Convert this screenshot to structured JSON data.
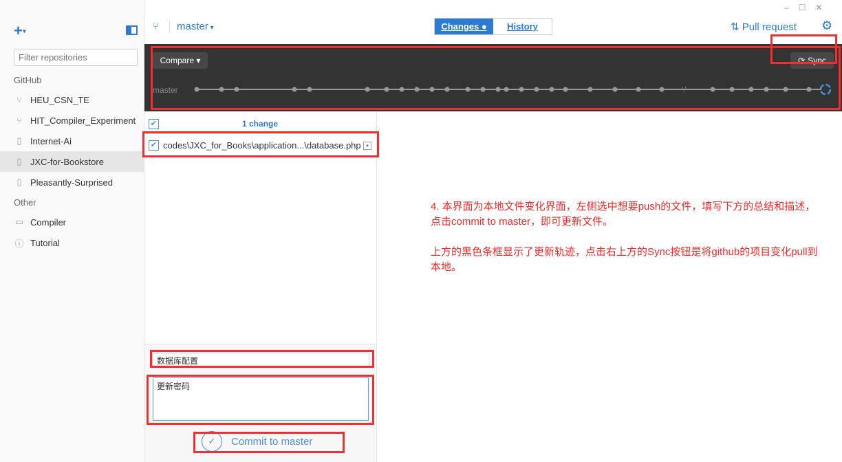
{
  "sidebar": {
    "add_icon": "plus-icon",
    "filter_placeholder": "Filter repositories",
    "sections": [
      {
        "title": "GitHub",
        "items": [
          {
            "label": "HEU_CSN_TE",
            "icon": "fork-icon"
          },
          {
            "label": "HIT_Compiler_Experiment",
            "icon": "fork-icon"
          },
          {
            "label": "Internet-Ai",
            "icon": "repo-icon"
          },
          {
            "label": "JXC-for-Bookstore",
            "icon": "repo-icon",
            "selected": true
          },
          {
            "label": "Pleasantly-Surprised",
            "icon": "repo-icon"
          }
        ]
      },
      {
        "title": "Other",
        "items": [
          {
            "label": "Compiler",
            "icon": "monitor-icon"
          },
          {
            "label": "Tutorial",
            "icon": "info-icon"
          }
        ]
      }
    ]
  },
  "toolbar": {
    "branch": "master",
    "tabs": [
      {
        "label": "Changes ●",
        "active": true
      },
      {
        "label": "History",
        "active": false
      }
    ],
    "pull_request": "Pull request"
  },
  "timeline": {
    "compare_label": "Compare ▾",
    "sync_label": "Sync",
    "branch_label": "master",
    "commit_count": 30
  },
  "changes": {
    "count_label": "1 change",
    "files": [
      {
        "path": "codes\\JXC_for_Books\\application...\\database.php",
        "checked": true
      }
    ]
  },
  "commit": {
    "summary": "数据库配置",
    "description": "更新密码",
    "button": "Commit to master"
  },
  "note": {
    "para1": "4. 本界面为本地文件变化界面，左侧选中想要push的文件，填写下方的总结和描述，点击commit to master，即可更新文件。",
    "para2": "上方的黑色条框显示了更新轨迹，点击右上方的Sync按钮是将github的项目变化pull到本地。"
  },
  "colors": {
    "accent": "#4a90d9",
    "annotation": "#f03030",
    "dark_bar": "#333333"
  }
}
